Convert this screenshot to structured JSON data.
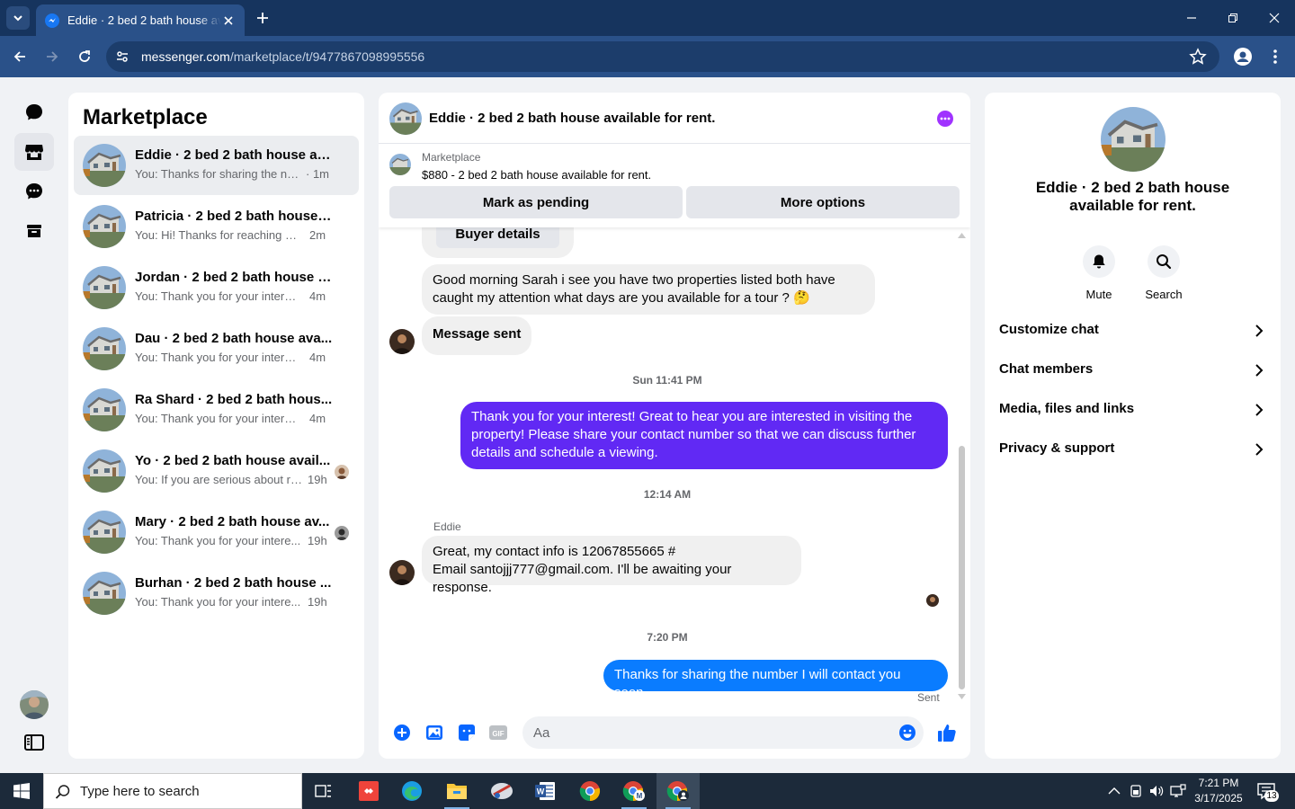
{
  "browser": {
    "tab_title": "Eddie · 2 bed 2 bath house available for rent.",
    "url_host": "messenger.com",
    "url_path": "/marketplace/t/9477867098995556"
  },
  "sidebar_title": "Marketplace",
  "conversations": [
    {
      "name": "Eddie · 2 bed 2 bath house av...",
      "preview": "You: Thanks for sharing the nu...",
      "time": "· 1m"
    },
    {
      "name": "Patricia · 2 bed 2 bath house ...",
      "preview": "You: Hi! Thanks for reaching ou...",
      "time": "2m"
    },
    {
      "name": "Jordan · 2 bed 2 bath house a...",
      "preview": "You: Thank you for your interes...",
      "time": "4m"
    },
    {
      "name": "Dau · 2 bed 2 bath house ava...",
      "preview": "You: Thank you for your interes...",
      "time": "4m"
    },
    {
      "name": "Ra Shard · 2 bed 2 bath hous...",
      "preview": "You: Thank you for your interes...",
      "time": "4m"
    },
    {
      "name": "Yo · 2 bed 2 bath house avail...",
      "preview": "You: If you are serious about re...",
      "time": "19h"
    },
    {
      "name": "Mary · 2 bed 2 bath house av...",
      "preview": "You: Thank you for your intere...",
      "time": "19h"
    },
    {
      "name": "Burhan · 2 bed 2 bath house ...",
      "preview": "You: Thank you for your intere...",
      "time": "19h"
    }
  ],
  "chat": {
    "title": "Eddie · 2 bed 2 bath house available for rent.",
    "listing_label": "Marketplace",
    "listing_desc": "$880 - 2 bed 2 bath house available for rent.",
    "mark_pending": "Mark as pending",
    "more_options": "More options",
    "buyer_details": "Buyer details",
    "msg_in_1_line1": "Good morning Sarah i see you have two properties listed both have",
    "msg_in_1_line2": "caught my attention what days are you available for a tour ? 🤔",
    "msg_in_2": "Message sent",
    "ts_1": "Sun 11:41 PM",
    "msg_out_1_line1": "Thank you for your interest! Great to hear you are interested in visiting the",
    "msg_out_1_line2": "property! Please share your contact number so that we can discuss further",
    "msg_out_1_line3": "details and schedule a viewing.",
    "ts_2": "12:14 AM",
    "sender": "Eddie",
    "msg_in_3_line1": "Great, my contact info is 12067855665 #",
    "msg_in_3_line2": "Email santojjj777@gmail.com. I'll be awaiting your response.",
    "ts_3": "7:20 PM",
    "msg_out_2": "Thanks for sharing the number I will contact you soon.",
    "status": "Sent",
    "composer_placeholder": "Aa"
  },
  "info": {
    "name_line1": "Eddie · 2 bed 2 bath house",
    "name_line2": "available for rent.",
    "mute": "Mute",
    "search": "Search",
    "rows": [
      "Customize chat",
      "Chat members",
      "Media, files and links",
      "Privacy & support"
    ]
  },
  "taskbar": {
    "search_placeholder": "Type here to search",
    "time": "7:21 PM",
    "date": "3/17/2025",
    "notifications": "13"
  },
  "colors": {
    "accent_purple": "#6129f4",
    "accent_blue": "#0a7cff",
    "messenger_blue": "#0866ff"
  },
  "icons": [
    "chats-icon",
    "marketplace-icon",
    "requests-icon",
    "archive-icon",
    "bell-icon",
    "search-icon",
    "chevron-right-icon",
    "plus-circle-icon",
    "image-icon",
    "sticker-icon",
    "gif-icon",
    "emoji-icon",
    "thumbs-up-icon"
  ]
}
